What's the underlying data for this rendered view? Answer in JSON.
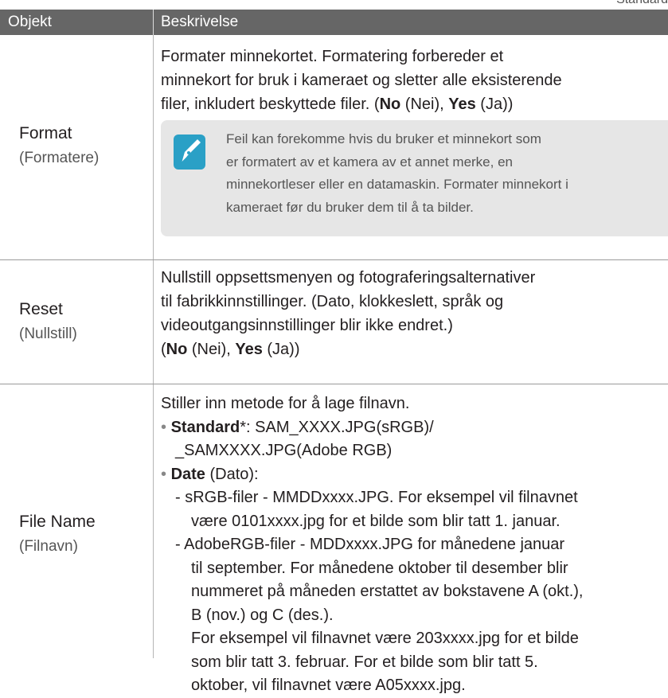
{
  "corner_label": "Standard",
  "header": {
    "col1": "Objekt",
    "col2": "Beskrivelse"
  },
  "rows": {
    "format": {
      "name": "Format",
      "sub": "(Formatere)",
      "desc_line1": "Formater minnekortet. Formatering forbereder et",
      "desc_line2": "minnekort for bruk i kameraet og sletter alle eksisterende",
      "desc_line3_pre": "filer, inkludert beskyttede filer. (",
      "no": "No",
      "nei": " (Nei), ",
      "yes": "Yes",
      "ja": " (Ja))",
      "note_icon": "pen-note-icon",
      "note_line1": "Feil kan forekomme hvis du bruker et minnekort som",
      "note_line2": "er formatert av et kamera av et annet merke, en",
      "note_line3": "minnekortleser eller en datamaskin. Formater minnekort i",
      "note_line4": "kameraet før du bruker dem til å ta bilder."
    },
    "reset": {
      "name": "Reset",
      "sub": "(Nullstill)",
      "desc_line1": "Nullstill oppsettsmenyen og fotograferingsalternativer",
      "desc_line2": "til fabrikkinnstillinger. (Dato, klokkeslett, språk og",
      "desc_line3": "videoutgangsinnstillinger blir ikke endret.)",
      "desc_line4_open": "(",
      "no": "No",
      "nei": " (Nei), ",
      "yes": "Yes",
      "ja": " (Ja))"
    },
    "filename": {
      "name": "File Name",
      "sub": "(Filnavn)",
      "intro": "Stiller inn metode for å lage filnavn.",
      "bullet": "•",
      "standard_label": "Standard",
      "standard_star": "*: SAM_XXXX.JPG(sRGB)/",
      "standard_line2": "_SAMXXXX.JPG(Adobe RGB)",
      "date_label": "Date",
      "date_rest": " (Dato):",
      "dash": "-",
      "srgb_line1": "sRGB-filer - MMDDxxxx.JPG. For eksempel vil filnavnet",
      "srgb_line2": "være 0101xxxx.jpg for et bilde som blir tatt 1. januar.",
      "adobe_line1": "AdobeRGB-filer - MDDxxxx.JPG for månedene januar",
      "adobe_line2": "til september. For månedene oktober til desember blir",
      "adobe_line3": "nummeret på måneden erstattet av bokstavene A (okt.),",
      "adobe_line4": "B (nov.) og C (des.).",
      "adobe_line5": "For eksempel vil filnavnet være 203xxxx.jpg for et bilde",
      "adobe_line6": "som blir tatt 3. februar. For et bilde som blir tatt 5.",
      "adobe_line7": "oktober, vil filnavnet være A05xxxx.jpg."
    }
  }
}
